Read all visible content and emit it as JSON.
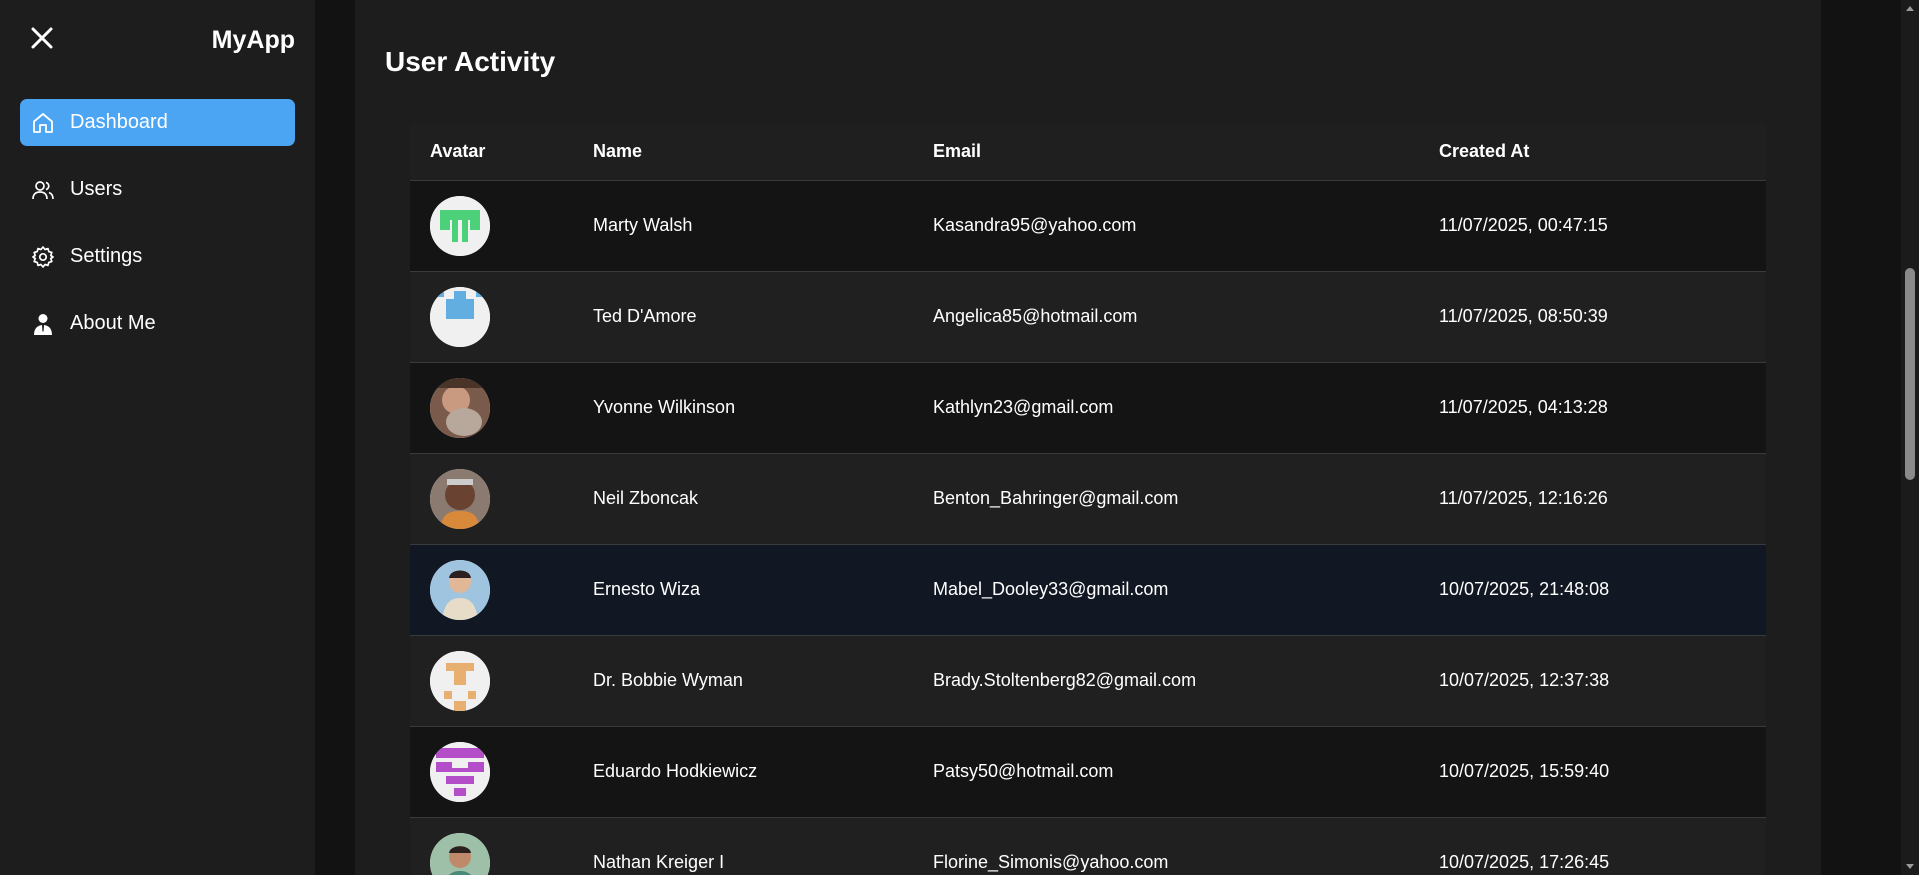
{
  "app": {
    "name": "MyApp"
  },
  "sidebar": {
    "items": [
      {
        "label": "Dashboard",
        "icon": "home-icon",
        "active": true
      },
      {
        "label": "Users",
        "icon": "users-icon",
        "active": false
      },
      {
        "label": "Settings",
        "icon": "gear-icon",
        "active": false
      },
      {
        "label": "About Me",
        "icon": "person-icon",
        "active": false
      }
    ]
  },
  "main": {
    "title": "User Activity",
    "table": {
      "headers": [
        "Avatar",
        "Name",
        "Email",
        "Created At"
      ],
      "rows": [
        {
          "name": "Marty Walsh",
          "email": "Kasandra95@yahoo.com",
          "created_at": "11/07/2025, 00:47:15"
        },
        {
          "name": "Ted D'Amore",
          "email": "Angelica85@hotmail.com",
          "created_at": "11/07/2025, 08:50:39"
        },
        {
          "name": "Yvonne Wilkinson",
          "email": "Kathlyn23@gmail.com",
          "created_at": "11/07/2025, 04:13:28"
        },
        {
          "name": "Neil Zboncak",
          "email": "Benton_Bahringer@gmail.com",
          "created_at": "11/07/2025, 12:16:26"
        },
        {
          "name": "Ernesto Wiza",
          "email": "Mabel_Dooley33@gmail.com",
          "created_at": "10/07/2025, 21:48:08"
        },
        {
          "name": "Dr. Bobbie Wyman",
          "email": "Brady.Stoltenberg82@gmail.com",
          "created_at": "10/07/2025, 12:37:38"
        },
        {
          "name": "Eduardo Hodkiewicz",
          "email": "Patsy50@hotmail.com",
          "created_at": "10/07/2025, 15:59:40"
        },
        {
          "name": "Nathan Kreiger I",
          "email": "Florine_Simonis@yahoo.com",
          "created_at": "10/07/2025, 17:26:45"
        }
      ]
    }
  },
  "colors": {
    "accent": "#4ca5f2",
    "background": "#1d1d1d",
    "hover_row": "#111823"
  }
}
